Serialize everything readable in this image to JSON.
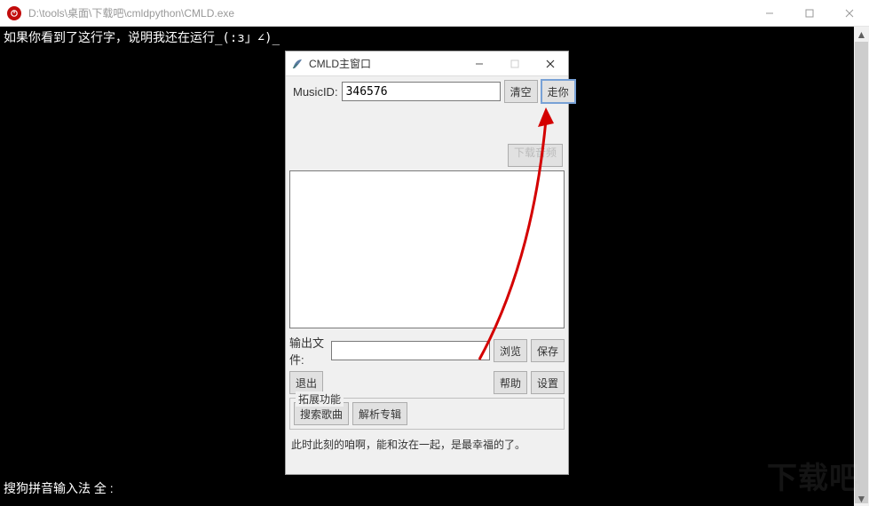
{
  "outer": {
    "title": "D:\\tools\\桌面\\下载吧\\cmldpython\\CMLD.exe"
  },
  "console": {
    "line1": "如果你看到了这行字，说明我还在运行_(:з」∠)_"
  },
  "ime": {
    "text": "搜狗拼音输入法 全 :"
  },
  "watermark": "下载吧",
  "tk": {
    "title": "CMLD主窗口",
    "musicid_label": "MusicID:",
    "musicid_value": "346576",
    "btn_clear": "清空",
    "btn_go": "走你",
    "btn_dlaudio": "下载音频",
    "outfile_label": "输出文件:",
    "outfile_value": "",
    "btn_browse": "浏览",
    "btn_save": "保存",
    "btn_exit": "退出",
    "btn_help": "帮助",
    "btn_settings": "设置",
    "fieldset_title": "拓展功能",
    "btn_search": "搜索歌曲",
    "btn_album": "解析专辑",
    "status": "此时此刻的咱啊，能和汝在一起，是最幸福的了。"
  }
}
